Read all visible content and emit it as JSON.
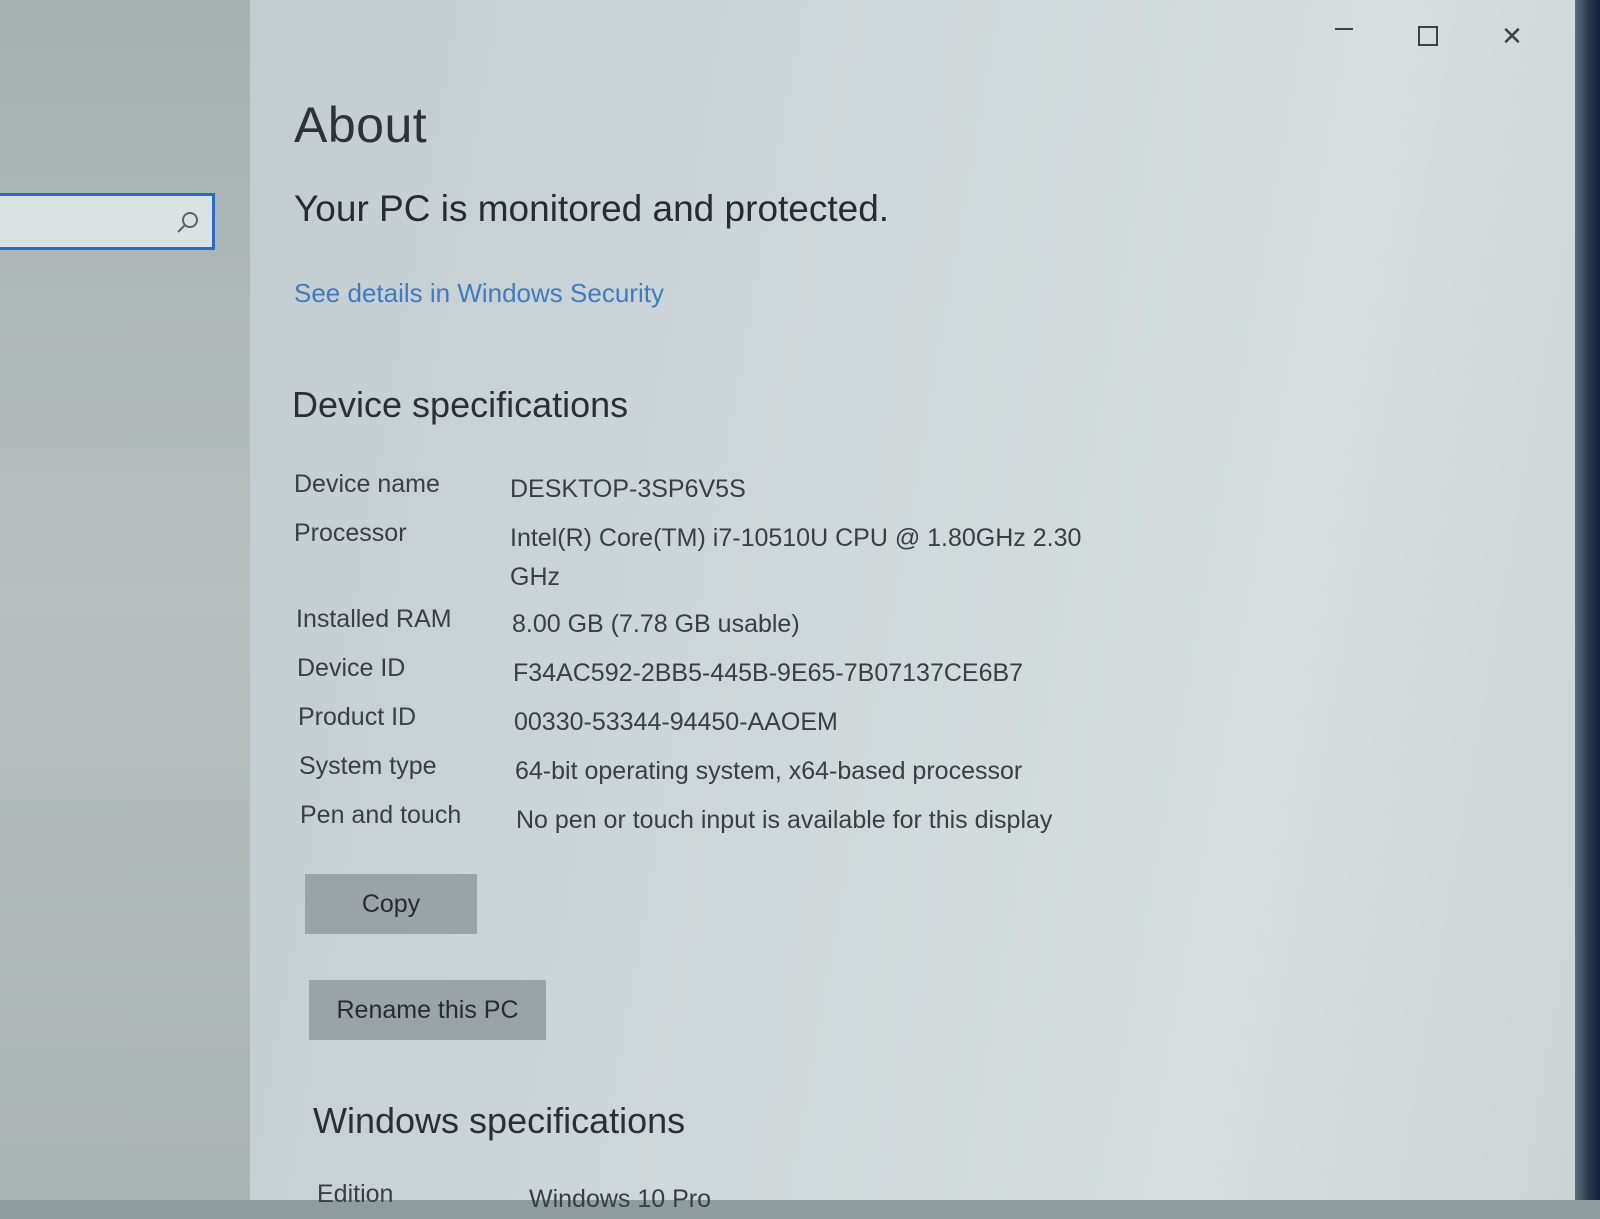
{
  "window_controls": {
    "minimize": "minimize",
    "maximize": "maximize",
    "close": "✕"
  },
  "search": {
    "value": "",
    "placeholder": ""
  },
  "page": {
    "title": "About",
    "status": "Your PC is monitored and protected.",
    "security_link": "See details in Windows Security"
  },
  "device_specs": {
    "title": "Device specifications",
    "rows": [
      {
        "label": "Device name",
        "value": "DESKTOP-3SP6V5S"
      },
      {
        "label": "Processor",
        "value": "Intel(R) Core(TM) i7-10510U CPU @ 1.80GHz   2.30 GHz"
      },
      {
        "label": "Installed RAM",
        "value": "8.00 GB (7.78 GB usable)"
      },
      {
        "label": "Device ID",
        "value": "F34AC592-2BB5-445B-9E65-7B07137CE6B7"
      },
      {
        "label": "Product ID",
        "value": "00330-53344-94450-AAOEM"
      },
      {
        "label": "System type",
        "value": "64-bit operating system, x64-based processor"
      },
      {
        "label": "Pen and touch",
        "value": "No pen or touch input is available for this display"
      }
    ],
    "copy_button": "Copy",
    "rename_button": "Rename this PC"
  },
  "windows_specs": {
    "title": "Windows specifications",
    "rows": [
      {
        "label": "Edition",
        "value": "Windows 10 Pro"
      }
    ]
  },
  "colors": {
    "accent": "#2a6cc4",
    "link": "#3f7bc1"
  }
}
